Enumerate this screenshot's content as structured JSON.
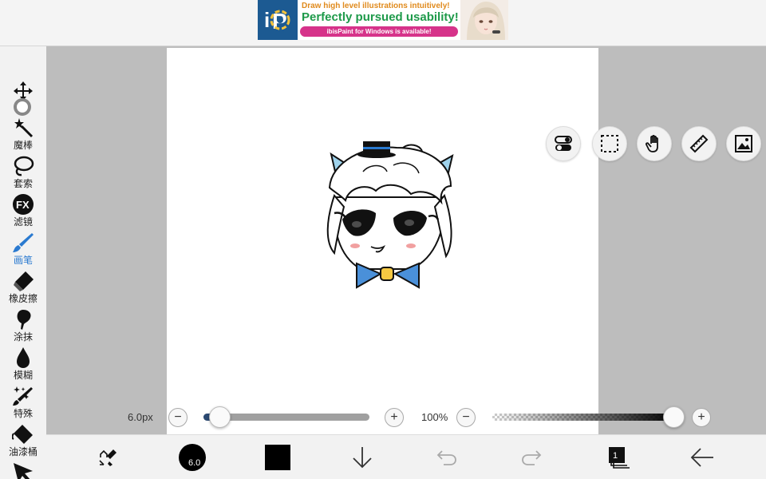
{
  "ad": {
    "line1": "Draw high level illustrations intuitively!",
    "line2": "Perfectly pursued usability!",
    "line3": "ibisPaint for Windows is available!",
    "logo_icon": "ibispaint-logo-icon"
  },
  "toolbar": {
    "tools": [
      {
        "name": "transform",
        "label": "",
        "icon": "move-arrows-icon"
      },
      {
        "name": "magic-wand",
        "label": "魔棒",
        "icon": "magic-wand-icon"
      },
      {
        "name": "lasso",
        "label": "套索",
        "icon": "lasso-icon"
      },
      {
        "name": "filter",
        "label": "滤镜",
        "icon": "fx-icon"
      },
      {
        "name": "brush",
        "label": "画笔",
        "icon": "brush-icon",
        "active": true
      },
      {
        "name": "eraser",
        "label": "橡皮擦",
        "icon": "eraser-icon"
      },
      {
        "name": "smudge",
        "label": "涂抹",
        "icon": "smudge-icon"
      },
      {
        "name": "blur",
        "label": "模糊",
        "icon": "drop-icon"
      },
      {
        "name": "special",
        "label": "特殊",
        "icon": "sparkle-brush-icon"
      },
      {
        "name": "fill",
        "label": "油漆桶",
        "icon": "bucket-icon"
      },
      {
        "name": "select",
        "label": "",
        "icon": "pointer-icon"
      }
    ],
    "active_color": "#2a7ad0"
  },
  "canvas_tools": [
    {
      "name": "toggle",
      "icon": "toggle-icon"
    },
    {
      "name": "selection",
      "icon": "dashed-selection-icon"
    },
    {
      "name": "hand",
      "icon": "hand-icon"
    },
    {
      "name": "ruler",
      "icon": "ruler-icon"
    },
    {
      "name": "material",
      "icon": "image-icon"
    }
  ],
  "sliders": {
    "brush_size_label": "6.0px",
    "brush_size_fraction": 0.06,
    "opacity_label": "100%",
    "opacity_value": 100,
    "minus": "−",
    "plus": "+"
  },
  "bottom_bar": {
    "brush_size_value": "6.0",
    "current_color": "#000000",
    "layer_count": "1",
    "icons": [
      "swap-tools-icon",
      "brush-size-icon",
      "color-swatch",
      "download-icon",
      "undo-icon",
      "redo-icon",
      "layers-icon",
      "back-arrow-icon"
    ]
  }
}
